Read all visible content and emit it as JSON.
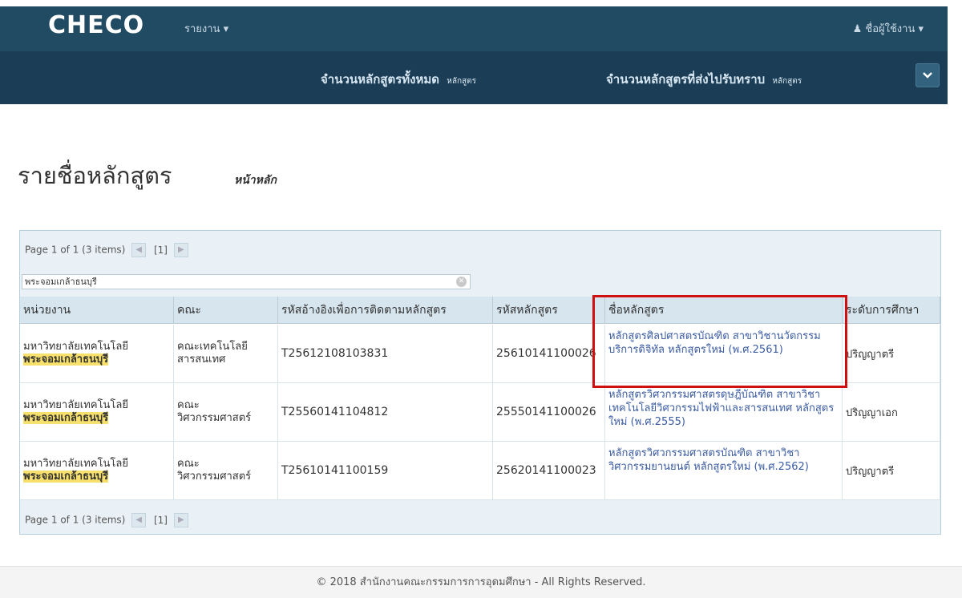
{
  "navbar": {
    "brand": "CHECO",
    "report_menu": "รายงาน ▾",
    "user_menu": "ชื่อผู้ใช้งาน ▾",
    "user_icon": "user-icon"
  },
  "stats": {
    "total_label": "จำนวนหลักสูตรทั้งหมด",
    "total_unit": "หลักสูตร",
    "sent_label": "จำนวนหลักสูตรที่ส่งไปรับทราบ",
    "sent_unit": "หลักสูตร",
    "toggle_icon": "chevron-down-icon"
  },
  "page": {
    "title": "รายชื่อหลักสูตร",
    "subtitle": "หน้าหลัก"
  },
  "grid": {
    "pager_text": "Page 1 of 1 (3 items)",
    "pager_page": "[1]",
    "filter_value": "พระจอมเกล้าธนบุรี",
    "columns": [
      "หน่วยงาน",
      "คณะ",
      "รหัสอ้างอิงเพื่อการติดตามหลักสูตร",
      "รหัสหลักสูตร",
      "ชื่อหลักสูตร",
      "ระดับการศึกษา"
    ],
    "rows": [
      {
        "unit_line1": "มหาวิทยาลัยเทคโนโลยี",
        "unit_line2": "พระจอมเกล้าธนบุรี",
        "faculty_line1": "คณะเทคโนโลยี",
        "faculty_line2": "สารสนเทศ",
        "ref_code": "T25612108103831",
        "course_code": "25610141100026",
        "course_name": "หลักสูตรศิลปศาสตรบัณฑิต สาขาวิชานวัตกรรมบริการดิจิทัล หลักสูตรใหม่ (พ.ศ.2561)",
        "level": "ปริญญาตรี"
      },
      {
        "unit_line1": "มหาวิทยาลัยเทคโนโลยี",
        "unit_line2": "พระจอมเกล้าธนบุรี",
        "faculty_line1": "คณะ",
        "faculty_line2": "วิศวกรรมศาสตร์",
        "ref_code": "T25560141104812",
        "course_code": "25550141100026",
        "course_name": "หลักสูตรวิศวกรรมศาสตรดุษฎีบัณฑิต สาขาวิชาเทคโนโลยีวิศวกรรมไฟฟ้าและสารสนเทศ หลักสูตรใหม่ (พ.ศ.2555)",
        "level": "ปริญญาเอก"
      },
      {
        "unit_line1": "มหาวิทยาลัยเทคโนโลยี",
        "unit_line2": "พระจอมเกล้าธนบุรี",
        "faculty_line1": "คณะ",
        "faculty_line2": "วิศวกรรมศาสตร์",
        "ref_code": "T25610141100159",
        "course_code": "25620141100023",
        "course_name": "หลักสูตรวิศวกรรมศาสตรบัณฑิต สาขาวิชาวิศวกรรมยานยนต์ หลักสูตรใหม่ (พ.ศ.2562)",
        "level": "ปริญญาตรี"
      }
    ]
  },
  "footer": {
    "text": "© 2018 สำนักงานคณะกรรมการการอุดมศึกษา - All Rights Reserved."
  },
  "colors": {
    "navbar": "#214b63",
    "subbar": "#1b3d55",
    "highlight": "#f7e06b",
    "link": "#3b5ca3",
    "annotation": "#d01010"
  }
}
